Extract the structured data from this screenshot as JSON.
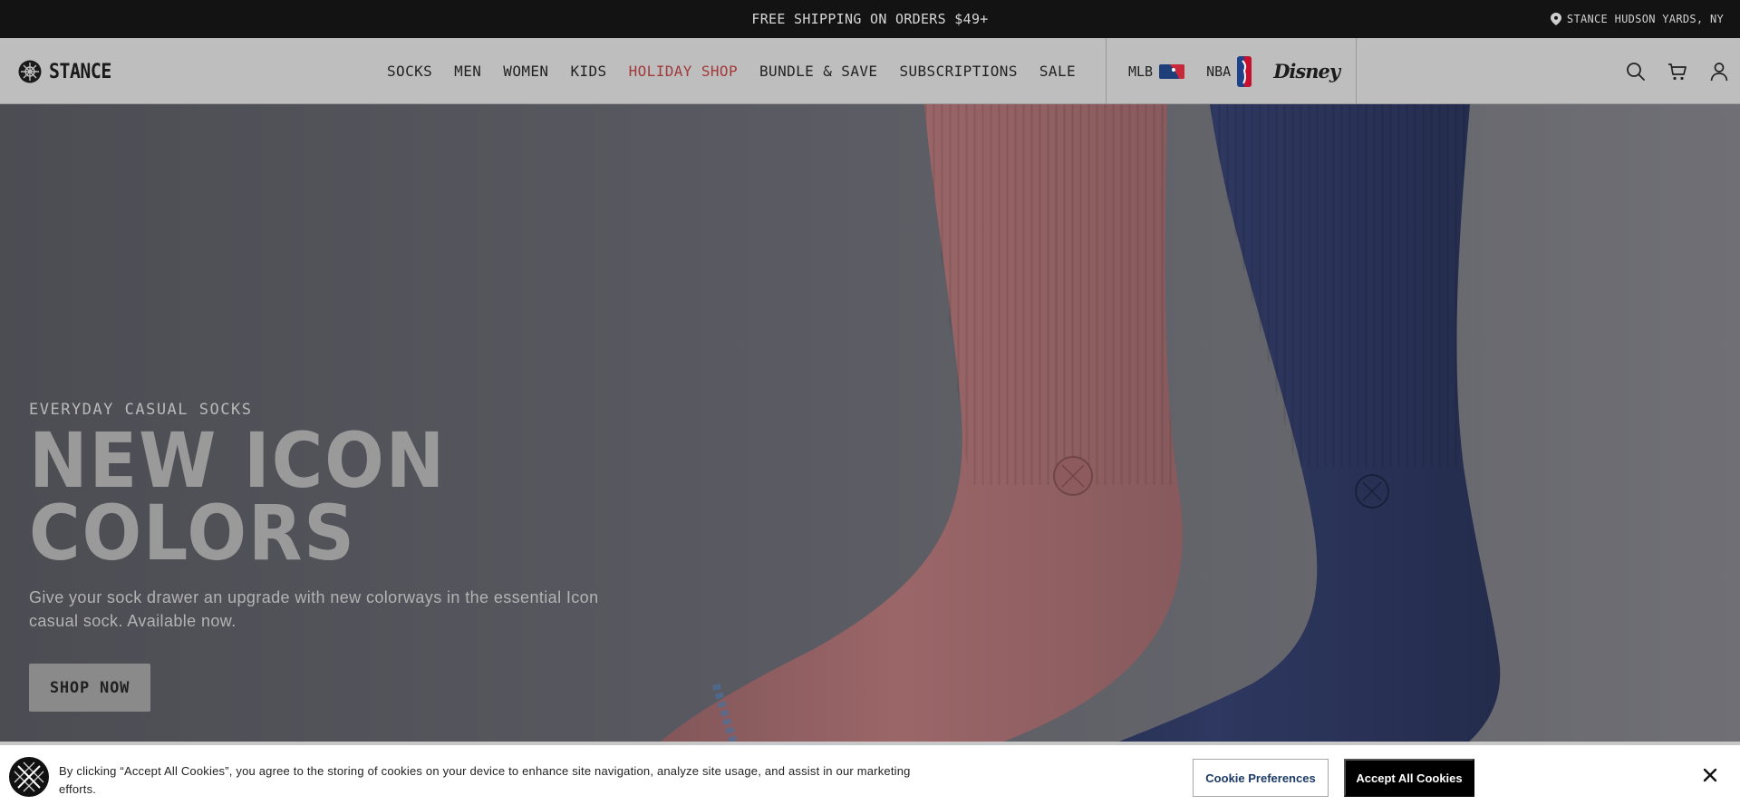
{
  "promo": {
    "text": "FREE SHIPPING ON ORDERS $49+"
  },
  "store": {
    "label": "STANCE HUDSON YARDS, NY",
    "icon": "location-pin-icon"
  },
  "header": {
    "logo_text": "STANCE",
    "nav": [
      {
        "label": "SOCKS"
      },
      {
        "label": "MEN"
      },
      {
        "label": "WOMEN"
      },
      {
        "label": "KIDS"
      },
      {
        "label": "HOLIDAY SHOP",
        "accent": true
      },
      {
        "label": "BUNDLE & SAVE"
      },
      {
        "label": "SUBSCRIPTIONS"
      },
      {
        "label": "SALE"
      }
    ],
    "partners": [
      {
        "label": "MLB",
        "icon": "mlb-logo-icon"
      },
      {
        "label": "NBA",
        "icon": "nba-logo-icon"
      },
      {
        "label": "Disney",
        "icon": "disney-logo-icon"
      }
    ],
    "icons": [
      "search-icon",
      "cart-icon",
      "account-icon"
    ],
    "accent_color": "#a13a3a"
  },
  "hero": {
    "eyebrow": "EVERYDAY CASUAL SOCKS",
    "headline_line1": "NEW ICON",
    "headline_line2": "COLORS",
    "subcopy": "Give your sock drawer an upgrade with new colorways in the essential Icon casual sock. Available now.",
    "cta_label": "SHOP NOW",
    "sock_colors": {
      "left": "#9a6466",
      "right": "#2b3457"
    }
  },
  "cookie_banner": {
    "text": "By clicking “Accept All Cookies”, you agree to the storing of cookies on your device to enhance site navigation, analyze site usage, and assist in our marketing efforts.",
    "preferences_label": "Cookie Preferences",
    "accept_label": "Accept All Cookies",
    "close_icon": "close-icon"
  }
}
